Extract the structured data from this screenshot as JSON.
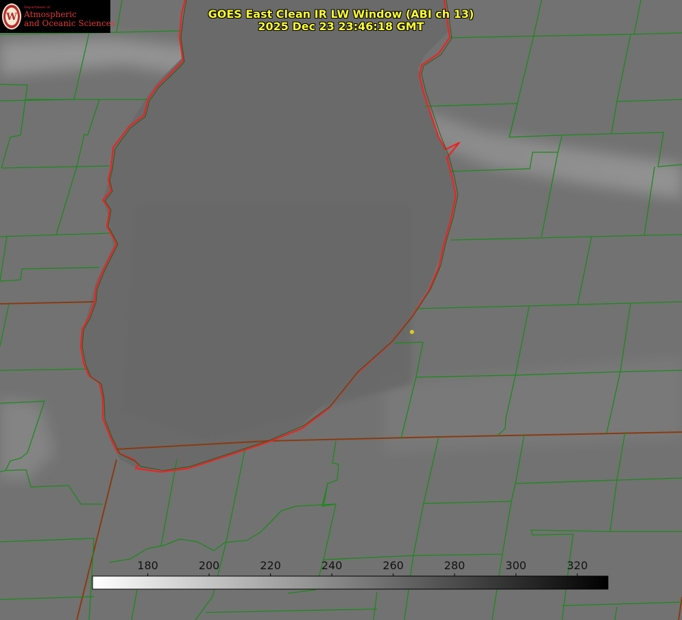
{
  "logo": {
    "dept": "Department of",
    "line1": "Atmospheric",
    "line2": "and Oceanic Sciences",
    "colors": {
      "text": "#e33a3a",
      "background": "#000000"
    }
  },
  "title": {
    "line1": "GOES East Clean IR LW Window (ABI ch 13)",
    "line2": "2025 Dec 23 23:46:18 GMT",
    "color": "#ffff33"
  },
  "colorbar": {
    "ticks": [
      "180",
      "200",
      "220",
      "240",
      "260",
      "280",
      "300",
      "320"
    ],
    "range": [
      162,
      330
    ],
    "colors": {
      "low": "#ffffff",
      "high": "#000000"
    }
  },
  "colors": {
    "county_lines": "#1a8a1a",
    "state_lines": "#8a3a10",
    "lake_outline": "#ee2222",
    "point_marker": "#ddcc22"
  }
}
